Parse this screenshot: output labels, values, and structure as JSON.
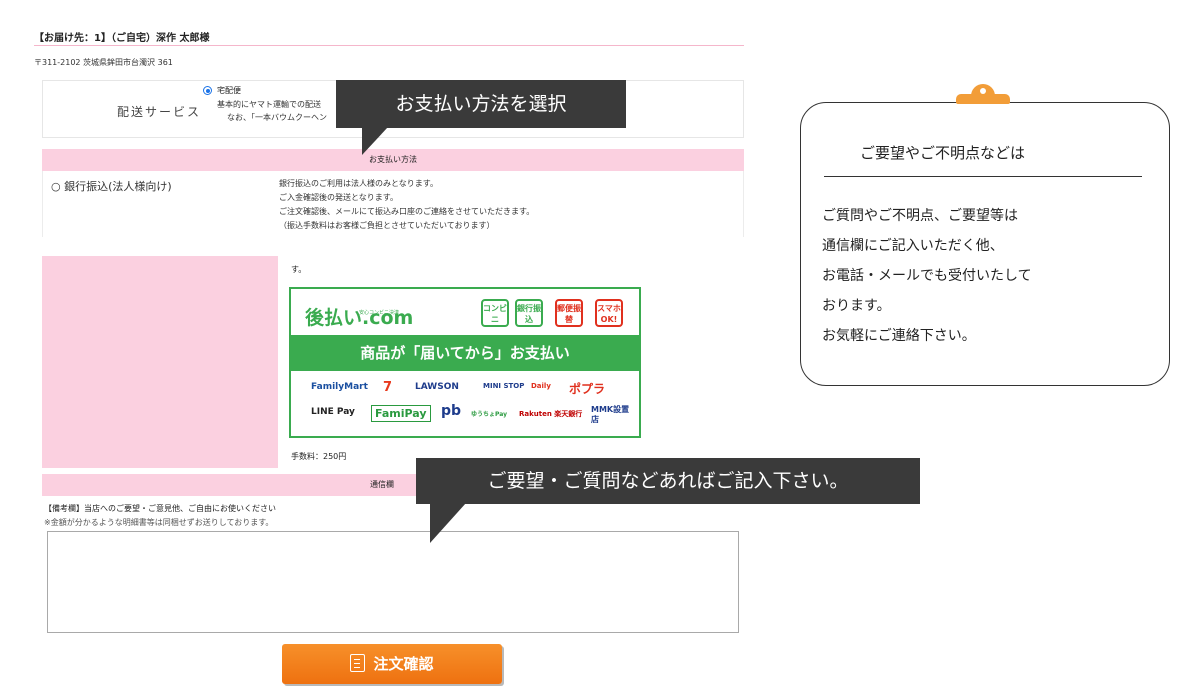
{
  "delivery": {
    "title": "【お届け先：1】（ご自宅）深作 太郎様",
    "address": "〒311-2102 茨城県鉾田市台濁沢 361"
  },
  "shipping": {
    "label": "配送サービス",
    "option": "宅配便",
    "note1": "基本的にヤマト運輸での配送",
    "note2": "なお、「一本バウムクーヘン"
  },
  "payment": {
    "header": "お支払い方法",
    "bank_label": "○ 銀行振込(法人様向け)",
    "bank_desc": [
      "銀行振込のご利用は法人様のみとなります。",
      "ご入金確認後の発送となります。",
      "ご注文確認後、メールにて振込み口座のご連絡をさせていただきます。",
      "（振込手数料はお客様ご負担とさせていただいております）"
    ],
    "atobarai_tail": "す。",
    "fee": "手数料：250円",
    "banner": {
      "logo": "後払い.com",
      "logo_sub": "安心コンビニ決済",
      "methods": [
        "コンビニ",
        "銀行振込",
        "郵便振替",
        "スマホOK!"
      ],
      "tagline": "商品が「届いてから」お支払い",
      "stores_row1": [
        "FamilyMart",
        "7",
        "LAWSON",
        "MINI STOP",
        "Daily",
        "ポプラ"
      ],
      "stores_row2": [
        "LINE Pay",
        "FamiPay",
        "pb",
        "ゆうちょPay",
        "Rakuten 楽天銀行",
        "MMK設置店"
      ]
    }
  },
  "communication": {
    "header": "通信欄",
    "memo_label": "【備考欄】当店へのご要望・ご意見他、ご自由にお使いください",
    "memo_note": "※金額が分かるような明細書等は同梱せずお送りしております。",
    "memo_value": ""
  },
  "confirm_button": "注文確認",
  "callouts": {
    "payment": "お支払い方法を選択",
    "request": "ご要望・ご質問などあればご記入下さい。"
  },
  "board": {
    "title": "ご要望やご不明点などは",
    "lines": [
      "ご質問やご不明点、ご要望等は",
      "通信欄にご記入いただく他、",
      "お電話・メールでも受付いたして",
      "おります。",
      "お気軽にご連絡下さい。"
    ]
  },
  "colors": {
    "header_pink": "#fbd0e0",
    "accent_green": "#3aab4f",
    "button_orange": "#f7902a",
    "callout_dark": "#3a3a3a",
    "clip_orange": "#f29d38"
  }
}
